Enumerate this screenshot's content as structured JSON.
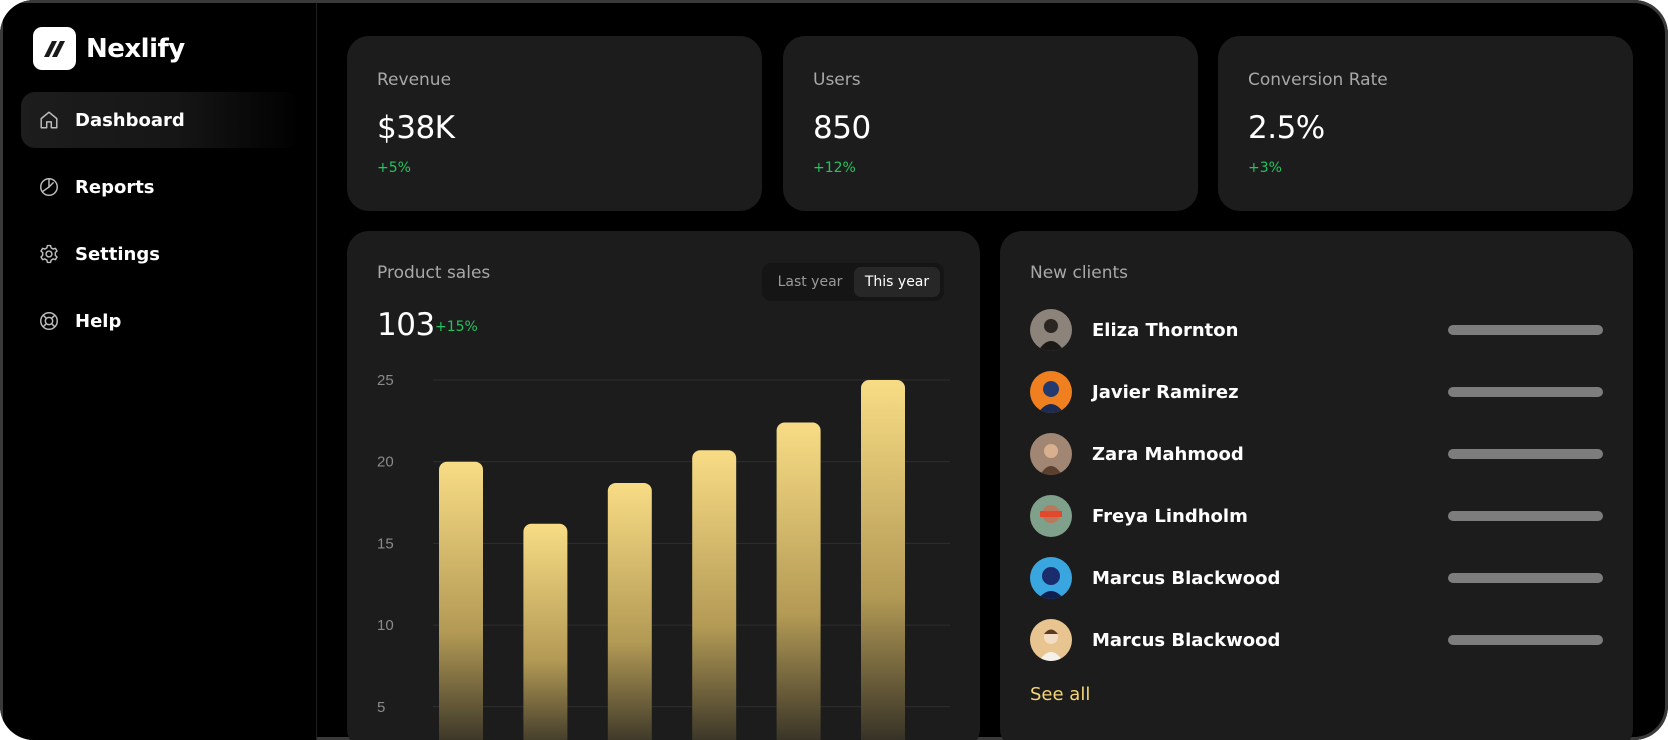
{
  "app": {
    "name": "Nexlify"
  },
  "sidebar": {
    "items": [
      {
        "label": "Dashboard",
        "icon": "home-icon",
        "active": true
      },
      {
        "label": "Reports",
        "icon": "pie-chart-icon",
        "active": false
      },
      {
        "label": "Settings",
        "icon": "gear-icon",
        "active": false
      },
      {
        "label": "Help",
        "icon": "lifebuoy-icon",
        "active": false
      }
    ]
  },
  "stats": [
    {
      "label": "Revenue",
      "value": "$38K",
      "delta": "+5%"
    },
    {
      "label": "Users",
      "value": "850",
      "delta": "+12%"
    },
    {
      "label": "Conversion Rate",
      "value": "2.5%",
      "delta": "+3%"
    }
  ],
  "product_sales": {
    "title": "Product sales",
    "toggle": {
      "last_year": "Last year",
      "this_year": "This year",
      "selected": "This year"
    },
    "total": "103",
    "delta": "+15%"
  },
  "chart_data": {
    "type": "bar",
    "title": "",
    "xlabel": "",
    "ylabel": "",
    "y_ticks": [
      25,
      20,
      15,
      10,
      5
    ],
    "ylim": [
      5,
      25
    ],
    "categories": [
      "",
      "",
      "",
      "",
      "",
      ""
    ],
    "values": [
      20,
      16.2,
      18.7,
      20.7,
      22.4,
      25
    ],
    "grid": true,
    "bar_color_top": "#f8dc85",
    "bar_color_bottom": "#1c1c1c"
  },
  "new_clients": {
    "title": "New clients",
    "clients": [
      {
        "name": "Eliza Thornton",
        "avatar": "avatar-man-dark"
      },
      {
        "name": "Javier Ramirez",
        "avatar": "avatar-orange-blue"
      },
      {
        "name": "Zara Mahmood",
        "avatar": "avatar-woman-tan"
      },
      {
        "name": "Freya Lindholm",
        "avatar": "avatar-green-red"
      },
      {
        "name": "Marcus Blackwood",
        "avatar": "avatar-blue-cyan"
      },
      {
        "name": "Marcus Blackwood",
        "avatar": "avatar-beige-man"
      }
    ],
    "see_all": "See all"
  },
  "colors": {
    "background": "#000000",
    "card": "#1c1c1c",
    "positive": "#22c55e",
    "accent": "#f5d577"
  }
}
